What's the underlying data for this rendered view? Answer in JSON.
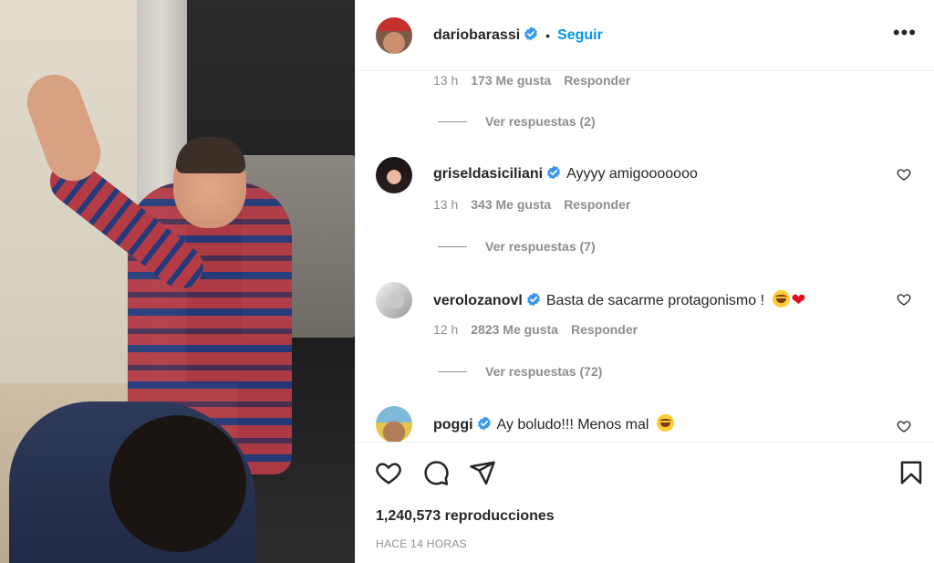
{
  "post": {
    "author": "dariobarassi",
    "separator": "•",
    "follow_label": "Seguir",
    "more_label": "•••"
  },
  "comments": {
    "top_partial": {
      "time": "13 h",
      "likes": "173 Me gusta",
      "reply": "Responder",
      "view_replies": "Ver respuestas (2)"
    },
    "items": [
      {
        "username": "griseldasiciliani",
        "text": "Ayyyy amigooooooo",
        "time": "13 h",
        "likes": "343 Me gusta",
        "reply": "Responder",
        "view_replies": "Ver respuestas (7)"
      },
      {
        "username": "verolozanovl",
        "text": "Basta de sacarme protagonismo !",
        "emojis": [
          "face-with-tears-of-joy",
          "red-heart"
        ],
        "time": "12 h",
        "likes": "2823 Me gusta",
        "reply": "Responder",
        "view_replies": "Ver respuestas (72)"
      },
      {
        "username": "poggi",
        "text": "Ay boludo!!! Menos mal",
        "emojis": [
          "face-with-tears-of-joy"
        ]
      }
    ]
  },
  "footer": {
    "views": "1,240,573 reproducciones",
    "posted_ago": "HACE 14 HORAS"
  },
  "icons": {
    "like": "heart-icon",
    "comment": "comment-bubble-icon",
    "share": "paper-plane-icon",
    "save": "bookmark-icon",
    "verified": "verified-badge-icon"
  },
  "colors": {
    "link_blue": "#0095f6",
    "verified_blue": "#3897f0",
    "muted_text": "#8e8e8e",
    "primary_text": "#262626"
  }
}
